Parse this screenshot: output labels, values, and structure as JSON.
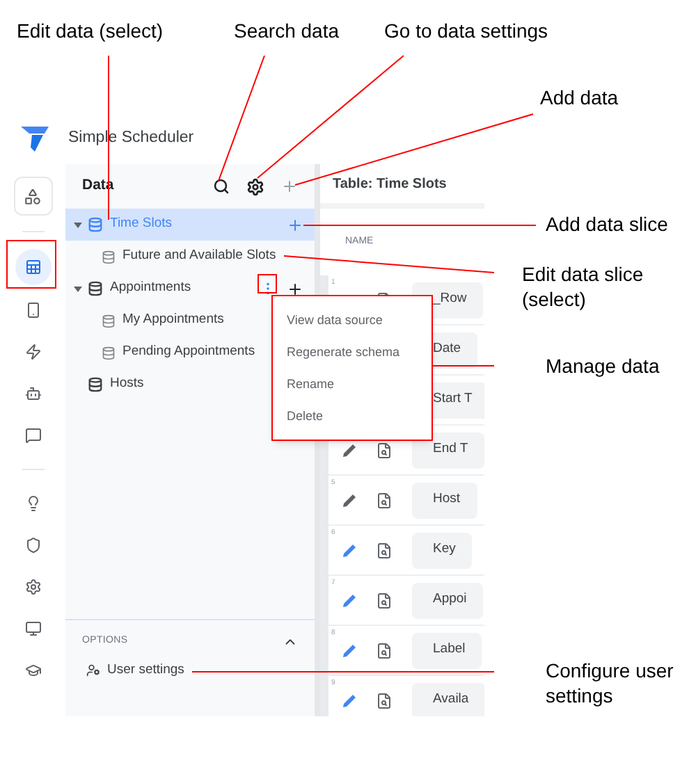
{
  "annotations": [
    {
      "text": "Edit data (select)"
    },
    {
      "text": "Search data"
    },
    {
      "text": "Go to data settings"
    },
    {
      "text": "Add data"
    },
    {
      "text": "Add data slice"
    },
    {
      "text": "Edit data slice (select)"
    },
    {
      "text": "Manage data"
    },
    {
      "text": "Configure user settings"
    }
  ],
  "app": {
    "title": "Simple Scheduler"
  },
  "rail": [
    {
      "selected": false
    },
    {
      "selected": true
    },
    {
      "selected": false
    },
    {
      "selected": false
    },
    {
      "selected": false
    },
    {
      "selected": false
    },
    {
      "selected": false
    },
    {
      "selected": false
    },
    {
      "selected": false
    },
    {
      "selected": false
    },
    {
      "selected": false
    }
  ],
  "data_panel": {
    "title": "Data",
    "tables": [
      {
        "label": "Time Slots",
        "selected": true,
        "expanded": true,
        "hovered": false,
        "children": [
          {
            "label": "Future and Available Slots"
          }
        ]
      },
      {
        "label": "Appointments",
        "selected": false,
        "expanded": true,
        "hovered": true,
        "children": [
          {
            "label": "My Appointments"
          },
          {
            "label": "Pending Appointments"
          }
        ]
      },
      {
        "label": "Hosts",
        "selected": false,
        "expanded": false,
        "hovered": false
      }
    ],
    "options": {
      "title": "OPTIONS",
      "expanded": true,
      "items": [
        {
          "label": "User settings"
        }
      ]
    }
  },
  "menu": {
    "items": [
      "View data source",
      "Regenerate schema",
      "Rename",
      "Delete"
    ]
  },
  "table": {
    "title": "Table: Time Slots",
    "columns": [
      "NAME"
    ],
    "rows": [
      {
        "number": "1",
        "name": "_Row"
      },
      {
        "name": "Date"
      },
      {
        "name": "Start T"
      },
      {
        "name": "End T",
        "color": "#5f6368"
      },
      {
        "number": "5",
        "name": "Host",
        "color": "#5f6368"
      },
      {
        "number": "6",
        "name": "Key",
        "color": "#4285f4"
      },
      {
        "number": "7",
        "name": "Appoi",
        "color": "#4285f4"
      },
      {
        "number": "8",
        "name": "Label",
        "color": "#4285f4"
      },
      {
        "number": "9",
        "name": "Availa",
        "color": "#4285f4"
      }
    ]
  }
}
